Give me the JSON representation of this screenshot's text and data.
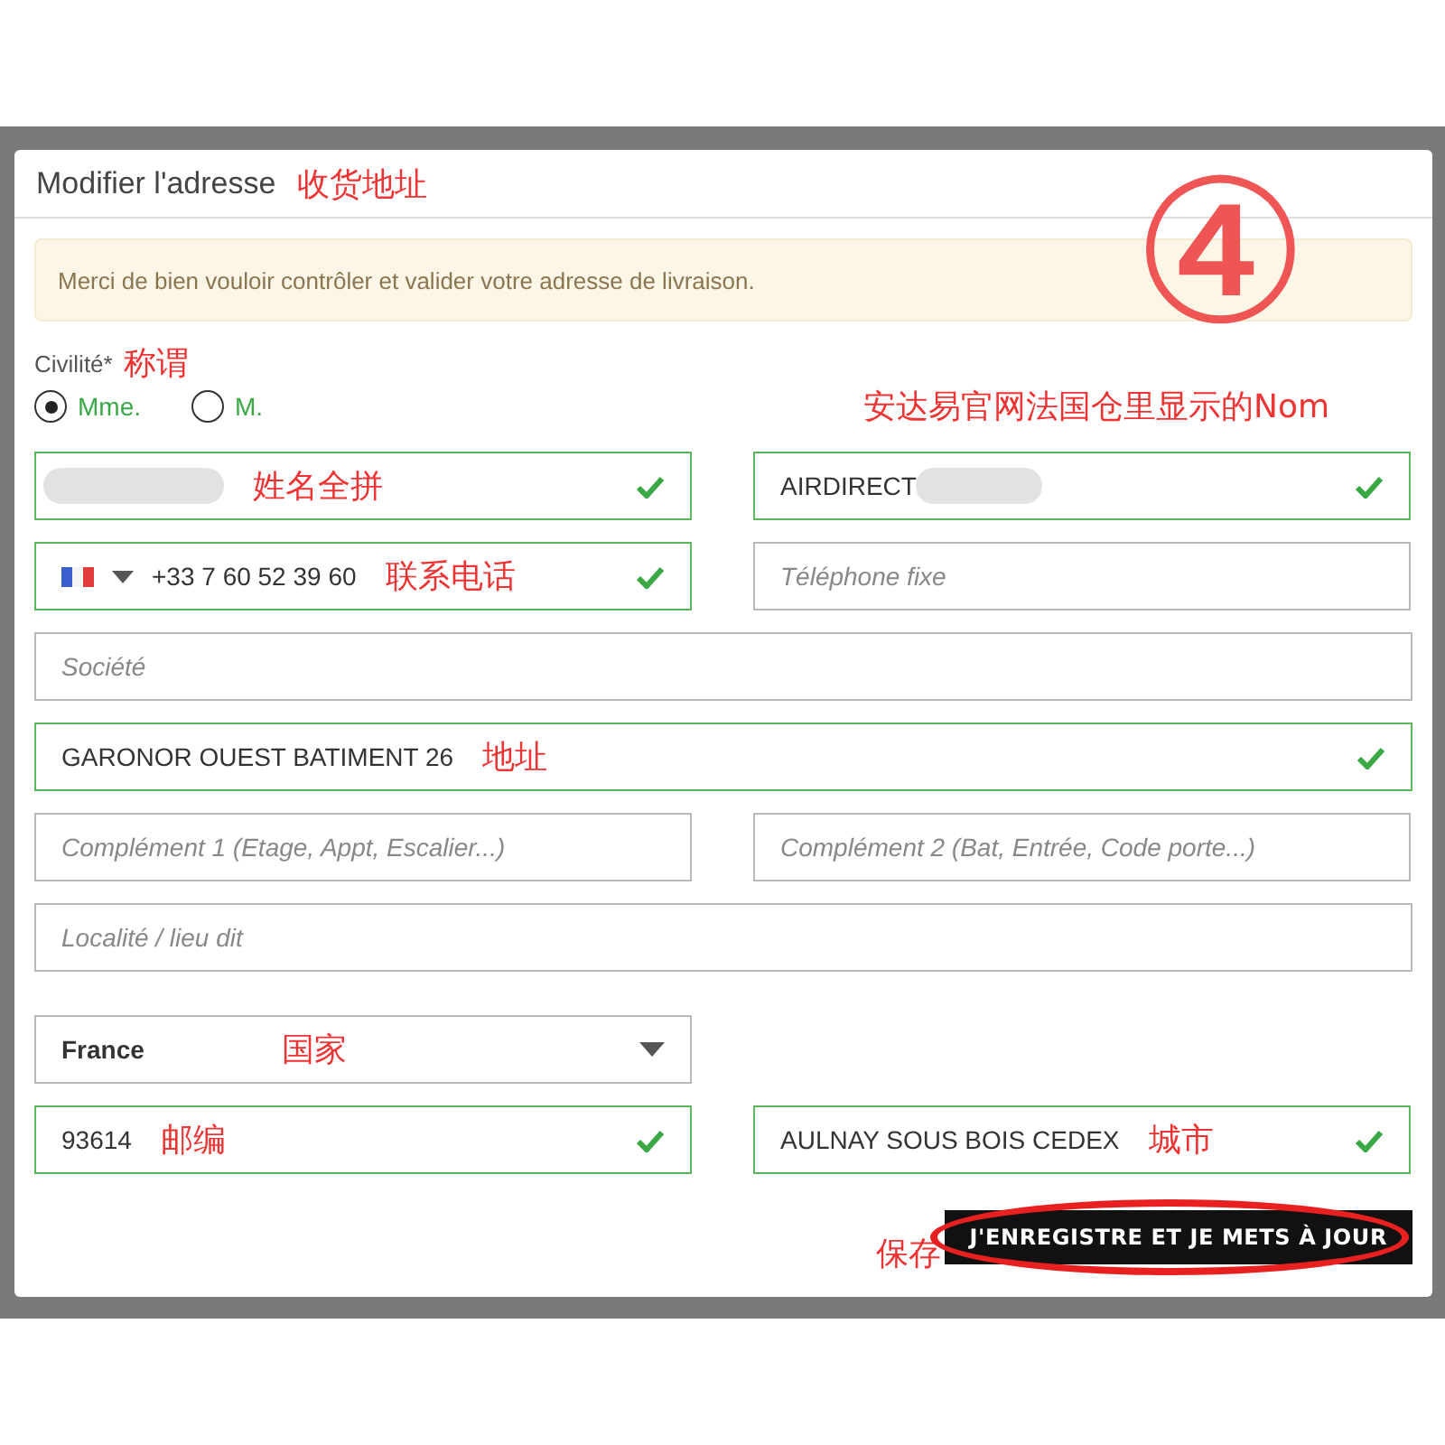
{
  "modal": {
    "title": "Modifier l'adresse",
    "annotation": "收货地址",
    "step_mark": "④"
  },
  "notice": "Merci de bien vouloir contrôler et valider votre adresse de livraison.",
  "civility": {
    "label": "Civilité*",
    "annotation": "称谓",
    "options": [
      {
        "label": "Mme.",
        "selected": true
      },
      {
        "label": "M.",
        "selected": false
      }
    ],
    "side_annotation": "安达易官网法国仓里显示的Nom"
  },
  "rows": [
    {
      "kind": "pair",
      "fields": [
        {
          "kind": "redacted",
          "valid": true,
          "annotation": "姓名全拼"
        },
        {
          "kind": "redacted",
          "value": "AIRDIRECT",
          "valid": true
        }
      ]
    },
    {
      "kind": "pair",
      "fields": [
        {
          "kind": "phone",
          "value": "+33 7 60 52 39 60",
          "valid": true,
          "annotation": "联系电话"
        },
        {
          "kind": "text",
          "placeholder": "Téléphone fixe",
          "valid": false
        }
      ]
    },
    {
      "kind": "full",
      "fields": [
        {
          "kind": "text",
          "placeholder": "Société",
          "valid": false
        }
      ]
    },
    {
      "kind": "full",
      "fields": [
        {
          "kind": "text",
          "value": "GARONOR OUEST BATIMENT 26",
          "valid": true,
          "annotation": "地址"
        }
      ]
    },
    {
      "kind": "pair",
      "fields": [
        {
          "kind": "text",
          "placeholder": "Complément 1 (Etage, Appt, Escalier...)",
          "valid": false
        },
        {
          "kind": "text",
          "placeholder": "Complément 2 (Bat, Entrée, Code porte...)",
          "valid": false
        }
      ]
    },
    {
      "kind": "full",
      "fields": [
        {
          "kind": "text",
          "placeholder": "Localité / lieu dit",
          "valid": false
        }
      ]
    },
    {
      "kind": "left",
      "fields": [
        {
          "kind": "select",
          "value": "France",
          "valid": false,
          "annotation": "国家"
        }
      ]
    },
    {
      "kind": "pair",
      "fields": [
        {
          "kind": "text",
          "value": "93614",
          "valid": true,
          "annotation": "邮编"
        },
        {
          "kind": "text",
          "value": "AULNAY SOUS BOIS CEDEX",
          "valid": true,
          "annotation": "城市"
        }
      ]
    }
  ],
  "save": {
    "label": "J'ENREGISTRE ET JE METS À JOUR",
    "annotation": "保存"
  }
}
